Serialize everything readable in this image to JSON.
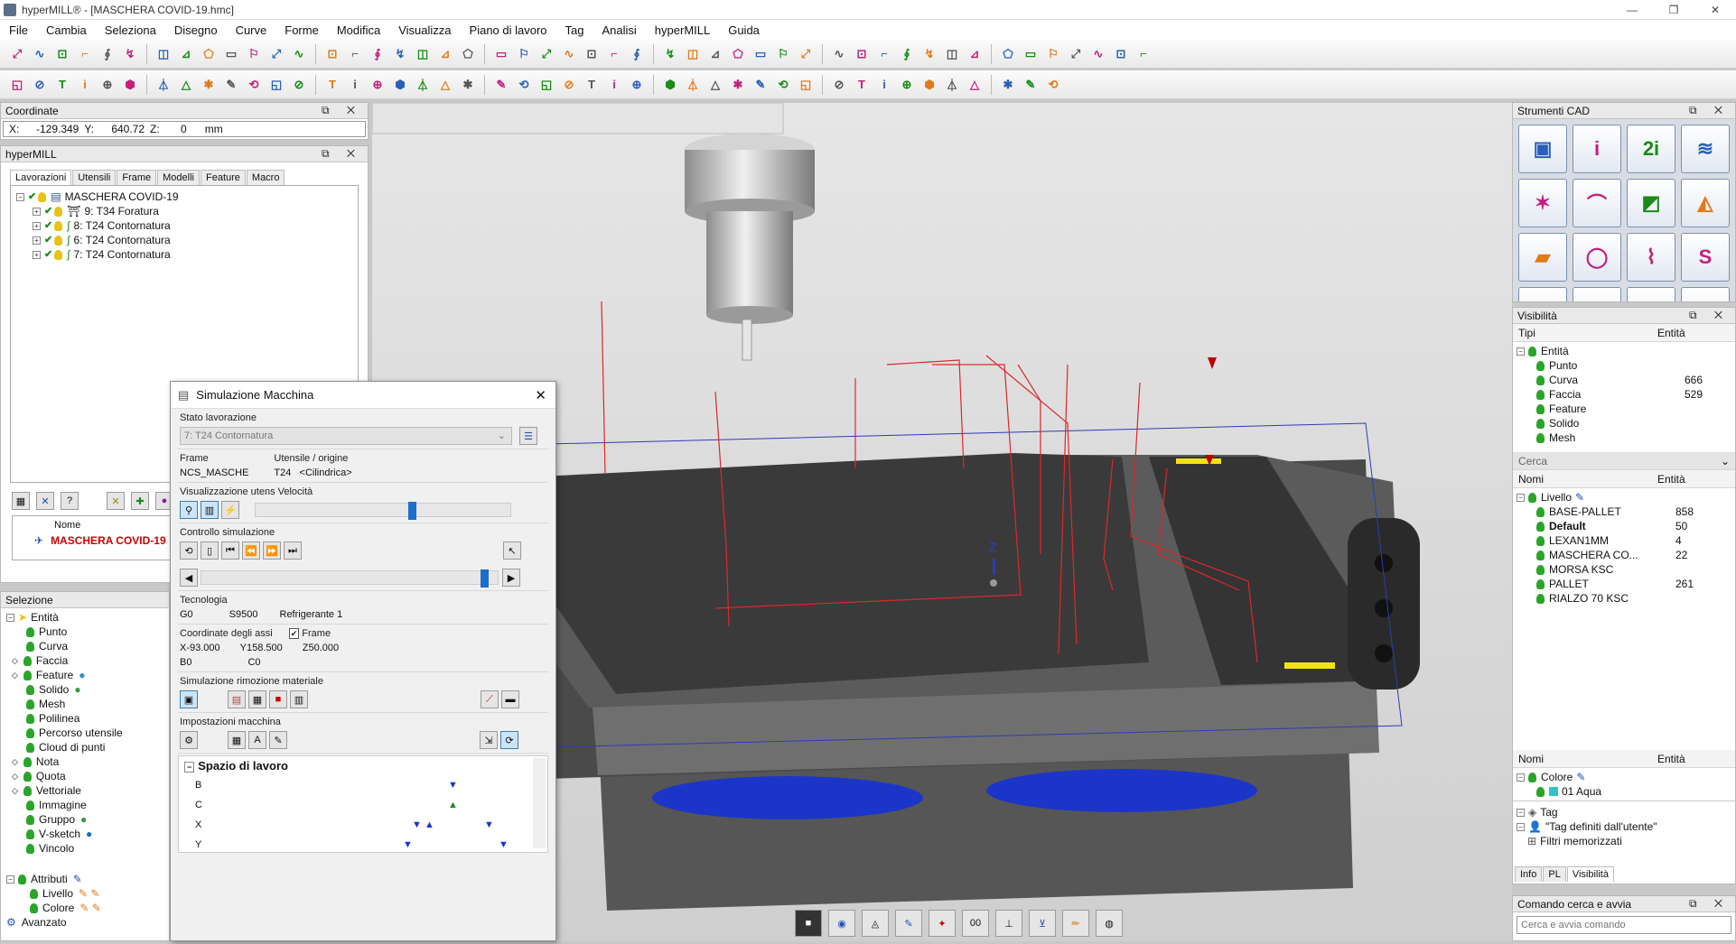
{
  "window": {
    "title": "hyperMILL® - [MASCHERA COVID-19.hmc]",
    "controls": [
      "—",
      "❐",
      "✕"
    ]
  },
  "menu": [
    "File",
    "Cambia",
    "Seleziona",
    "Disegno",
    "Curve",
    "Forme",
    "Modifica",
    "Visualizza",
    "Piano di lavoro",
    "Tag",
    "Analisi",
    "hyperMILL",
    "Guida"
  ],
  "coordinates": {
    "title": "Coordinate",
    "x_label": "X:",
    "x": "-129.349",
    "y_label": "Y:",
    "y": "640.72",
    "z_label": "Z:",
    "z": "0",
    "unit": "mm"
  },
  "hypermill": {
    "title": "hyperMILL",
    "tabs": [
      "Lavorazioni",
      "Utensili",
      "Frame",
      "Modelli",
      "Feature",
      "Macro"
    ],
    "active_tab": "Lavorazioni",
    "root": "MASCHERA COVID-19",
    "jobs": [
      "9: T34 Foratura",
      "8: T24 Contornatura",
      "6: T24 Contornatura",
      "7: T24 Contornatura"
    ],
    "list_header": "Nome",
    "list_item": "MASCHERA COVID-19"
  },
  "selezione": {
    "title": "Selezione",
    "root": "Entità",
    "items": [
      "Punto",
      "Curva",
      "Faccia",
      "Feature",
      "Solido",
      "Mesh",
      "Polilinea",
      "Percorso utensile",
      "Cloud di punti",
      "Nota",
      "Quota",
      "Vettoriale",
      "Immagine",
      "Gruppo",
      "V-sketch",
      "Vincolo"
    ],
    "attributi": "Attributi",
    "attr_items": [
      "Livello",
      "Colore"
    ],
    "avanzato": "Avanzato"
  },
  "sim": {
    "title": "Simulazione Macchina",
    "stato_label": "Stato lavorazione",
    "stato_value": "7: T24 Contornatura",
    "frame_label": "Frame",
    "frame_value": "NCS_MASCHE",
    "utensile_label": "Utensile / origine",
    "utensile_value": "T24",
    "utensile_type": "<Cilindrica>",
    "vis_label": "Visualizzazione utens Velocità",
    "controllo_label": "Controllo simulazione",
    "speed_fraction": 0.6,
    "progress_fraction": 0.97,
    "tecnologia_label": "Tecnologia",
    "g": "G0",
    "s": "S9500",
    "refrigerante": "Refrigerante  1",
    "coord_label": "Coordinate degli assi",
    "frame_check": "Frame",
    "x": "X-93.000",
    "y": "Y158.500",
    "z": "Z50.000",
    "b": "B0",
    "c": "C0",
    "rimozione_label": "Simulazione rimozione materiale",
    "impostazioni_label": "Impostazioni macchina",
    "spazio_label": "Spazio di lavoro",
    "axes": [
      "B",
      "C",
      "X",
      "Y"
    ]
  },
  "cad": {
    "title": "Strumenti CAD",
    "buttons": [
      "solid-icon",
      "i-icon",
      "2i-icon",
      "plane-icon",
      "star-icon",
      "curve-d-icon",
      "face-icon",
      "sweep-icon",
      "fill-icon",
      "circle-r-icon",
      "shape-icon",
      "spline-icon",
      "trim-icon"
    ]
  },
  "visibilita": {
    "title": "Visibilità",
    "col_tipi": "Tipi",
    "col_entita": "Entità",
    "root": "Entità",
    "rows": [
      {
        "name": "Punto",
        "count": ""
      },
      {
        "name": "Curva",
        "count": "666"
      },
      {
        "name": "Faccia",
        "count": "529"
      },
      {
        "name": "Feature",
        "count": ""
      },
      {
        "name": "Solido",
        "count": ""
      },
      {
        "name": "Mesh",
        "count": ""
      }
    ],
    "cerca": "Cerca",
    "col_nomi": "Nomi",
    "livello": "Livello",
    "levels": [
      {
        "name": "BASE-PALLET",
        "count": "858"
      },
      {
        "name": "Default",
        "count": "50"
      },
      {
        "name": "LEXAN1MM",
        "count": "4"
      },
      {
        "name": "MASCHERA CO...",
        "count": "22"
      },
      {
        "name": "MORSA KSC",
        "count": ""
      },
      {
        "name": "PALLET",
        "count": "261"
      },
      {
        "name": "RIALZO 70 KSC",
        "count": ""
      }
    ],
    "colore": "Colore",
    "color_item": "01 Aqua",
    "tag": "Tag",
    "tag_user": "\"Tag definiti dall'utente\"",
    "filtri": "Filtri memorizzati",
    "bottom_tabs": [
      "Info",
      "PL",
      "Visibilità"
    ]
  },
  "comando": {
    "title": "Comando cerca e avvia",
    "placeholder": "Cerca e avvia comando"
  },
  "axis_label": "Z"
}
